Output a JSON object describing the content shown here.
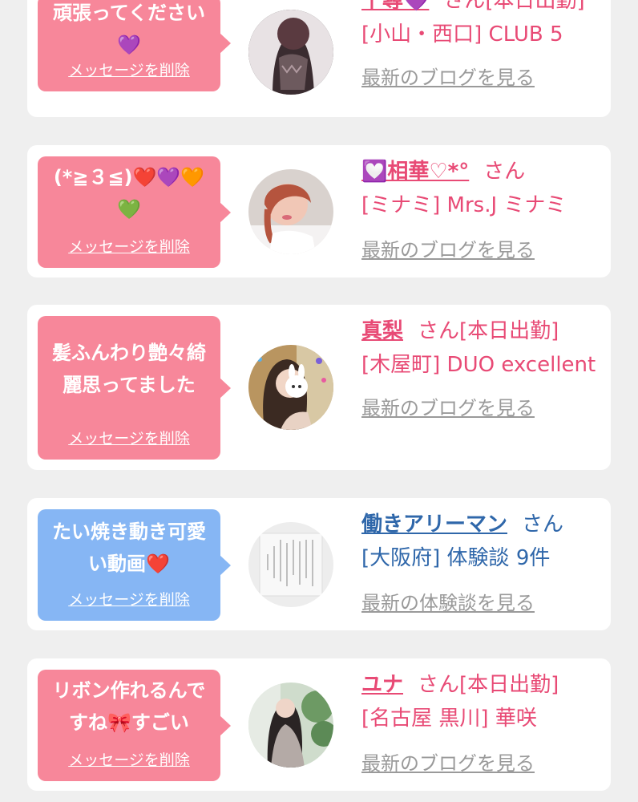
{
  "cards": [
    {
      "message": "頑張ってください💜",
      "delete_label": "メッセージを削除",
      "name": "千尋💜",
      "san": "さん",
      "status": "[本日出勤]",
      "shop": "[小山・西口] CLUB 5",
      "blog_link": "最新のブログを見る"
    },
    {
      "message": "(*≧３≦)❤️💜🧡💚",
      "delete_label": "メッセージを削除",
      "name": "💟相華♡*°",
      "san": "さん",
      "status": "",
      "shop": "[ミナミ] Mrs.J ミナミ",
      "blog_link": "最新のブログを見る"
    },
    {
      "message": "髪ふんわり艶々綺麗思ってました",
      "delete_label": "メッセージを削除",
      "name": "真梨",
      "san": "さん",
      "status": "[本日出勤]",
      "shop": "[木屋町] DUO excellent",
      "blog_link": "最新のブログを見る"
    },
    {
      "message": "たい焼き動き可愛い動画❤️",
      "delete_label": "メッセージを削除",
      "name": "働きアリーマン",
      "san": "さん",
      "status": "",
      "shop": "[大阪府] 体験談 9件",
      "blog_link": "最新の体験談を見る"
    },
    {
      "message": "リボン作れるんですね🎀すごい",
      "delete_label": "メッセージを削除",
      "name": "ユナ",
      "san": "さん",
      "status": "[本日出勤]",
      "shop": "[名古屋 黒川] 華咲",
      "blog_link": "最新のブログを見る"
    }
  ],
  "colors": {
    "background": "#efefef",
    "card": "#ffffff",
    "bubble_pink": "#f7879a",
    "bubble_blue": "#86b6f4",
    "text_pink": "#e84a75",
    "text_blue": "#2f67aa",
    "link_gray": "#9a9a9a"
  }
}
